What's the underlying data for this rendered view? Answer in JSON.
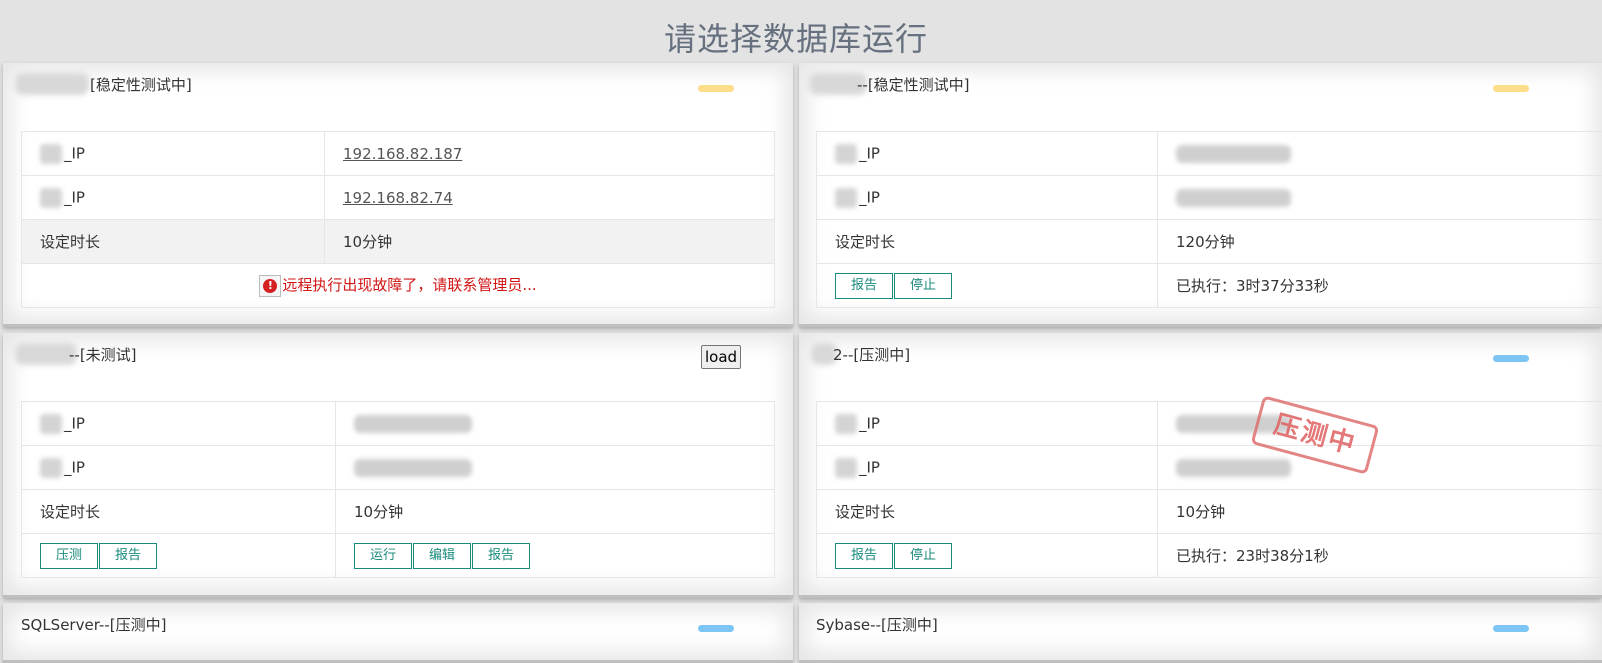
{
  "page_title": "请选择数据库运行",
  "colors": {
    "status_yellow": "#fedd8a",
    "status_blue": "#7cc5f5",
    "button_teal": "#1a8a7c",
    "error_red": "#d21515"
  },
  "cards": [
    {
      "title": "[稳定性测试中]",
      "status_color": "yellow",
      "rows": [
        {
          "label": "_IP",
          "value": "192.168.82.187"
        },
        {
          "label": "_IP",
          "value": "192.168.82.74"
        },
        {
          "label": "设定时长",
          "value": "10分钟"
        }
      ],
      "error_text": "远程执行出现故障了，请联系管理员..."
    },
    {
      "title": "--[稳定性测试中]",
      "status_color": "yellow",
      "rows": [
        {
          "label": "_IP",
          "value": ""
        },
        {
          "label": "_IP",
          "value": ""
        },
        {
          "label": "设定时长",
          "value": "120分钟"
        }
      ],
      "buttons": [
        "报告",
        "停止"
      ],
      "executed": "已执行：3时37分33秒"
    },
    {
      "title": "--[未测试]",
      "load_label": "load",
      "rows": [
        {
          "label": "_IP",
          "value": ""
        },
        {
          "label": "_IP",
          "value": ""
        },
        {
          "label": "设定时长",
          "value": "10分钟"
        }
      ],
      "buttons_left": [
        "压测",
        "报告"
      ],
      "buttons_right": [
        "运行",
        "编辑",
        "报告"
      ]
    },
    {
      "title": "2--[压测中]",
      "status_color": "blue",
      "stamp": "压测中",
      "rows": [
        {
          "label": "_IP",
          "value": ""
        },
        {
          "label": "_IP",
          "value": ""
        },
        {
          "label": "设定时长",
          "value": "10分钟"
        }
      ],
      "buttons": [
        "报告",
        "停止"
      ],
      "executed": "已执行：23时38分1秒"
    },
    {
      "title": "SQLServer--[压测中]",
      "status_color": "blue"
    },
    {
      "title": "Sybase--[压测中]",
      "status_color": "blue"
    }
  ]
}
